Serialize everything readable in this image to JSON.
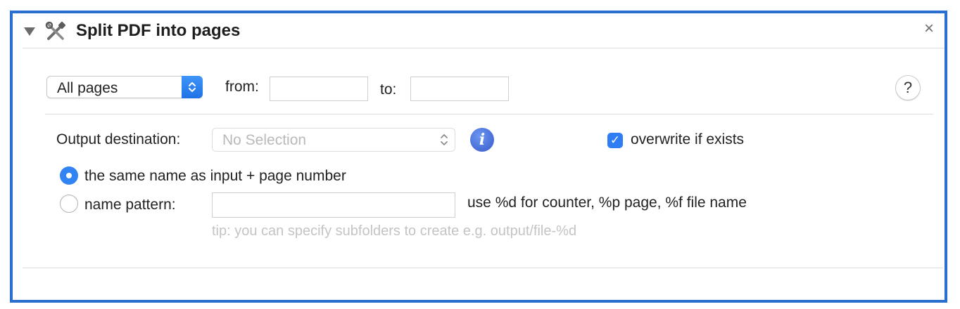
{
  "header": {
    "title": "Split PDF into pages",
    "close_glyph": "×"
  },
  "range": {
    "mode_selected": "All pages",
    "from_label": "from:",
    "from_value": "",
    "to_label": "to:",
    "to_value": "",
    "help_glyph": "?"
  },
  "output": {
    "destination_label": "Output destination:",
    "destination_value": "No Selection",
    "overwrite_label": "overwrite if exists",
    "overwrite_checked": true
  },
  "naming": {
    "option_same_label": "the same name as input + page number",
    "option_pattern_label": "name pattern:",
    "selected": "same",
    "pattern_value": "",
    "pattern_hint": "use %d for counter, %p page, %f file name",
    "tip": "tip: you can specify subfolders to create e.g. output/file-%d"
  },
  "colors": {
    "frame_border": "#2a6fcf",
    "accent": "#3284f2",
    "info": "#3659c9"
  },
  "icons": {
    "disclosure": "disclosure-triangle-icon",
    "tool": "tools-icon",
    "close": "close-icon",
    "help": "help-icon",
    "info": "info-icon",
    "stepper": "chevron-updown-icon",
    "check": "checkmark-icon"
  }
}
